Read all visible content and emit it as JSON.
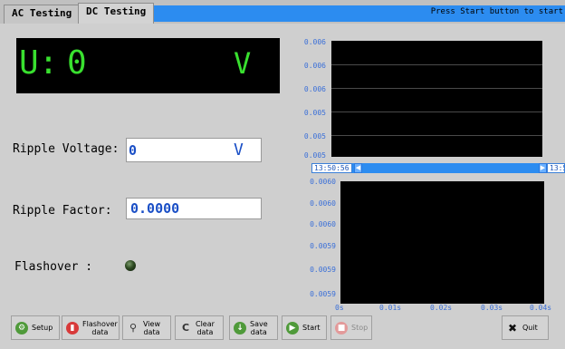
{
  "tabs": [
    {
      "label": "AC Testing",
      "active": false
    },
    {
      "label": "DC Testing",
      "active": true
    }
  ],
  "status": {
    "message": "Press Start button to start"
  },
  "voltage_display": {
    "prefix": "U:",
    "value": "0",
    "unit": "V",
    "color": "#39e02f"
  },
  "ripple_voltage": {
    "label": "Ripple Voltage:",
    "value": "0",
    "unit": "V"
  },
  "ripple_factor": {
    "label": "Ripple Factor:",
    "value": "0.0000"
  },
  "flashover": {
    "label": "Flashover :",
    "indicator": "off"
  },
  "top_chart": {
    "y_ticks": [
      "0.006",
      "0.006",
      "0.006",
      "0.005",
      "0.005",
      "0.005"
    ],
    "scroll_start": "13:50:56",
    "scroll_end": "13:59:16"
  },
  "bottom_chart": {
    "y_ticks": [
      "0.0060",
      "0.0060",
      "0.0060",
      "0.0059",
      "0.0059",
      "0.0059"
    ],
    "x_ticks": [
      "0s",
      "0.01s",
      "0.02s",
      "0.03s",
      "0.04s"
    ]
  },
  "buttons": {
    "setup": "Setup",
    "flashover_data": "Flashover\ndata",
    "view_data": "View\ndata",
    "clear_data": "Clear\ndata",
    "save_data": "Save\ndata",
    "start": "Start",
    "stop": "Stop",
    "quit": "Quit"
  },
  "chart_data": [
    {
      "type": "line",
      "title": "",
      "xlabel": "",
      "ylabel": "",
      "x_range": [
        "13:50:56",
        "13:59:16"
      ],
      "y_ticks": [
        0.006,
        0.006,
        0.006,
        0.005,
        0.005,
        0.005
      ],
      "series": [],
      "grid": true
    },
    {
      "type": "line",
      "title": "",
      "xlabel": "",
      "ylabel": "",
      "x_ticks": [
        "0s",
        "0.01s",
        "0.02s",
        "0.03s",
        "0.04s"
      ],
      "y_ticks": [
        0.006,
        0.006,
        0.006,
        0.0059,
        0.0059,
        0.0059
      ],
      "series": [],
      "grid": false
    }
  ]
}
